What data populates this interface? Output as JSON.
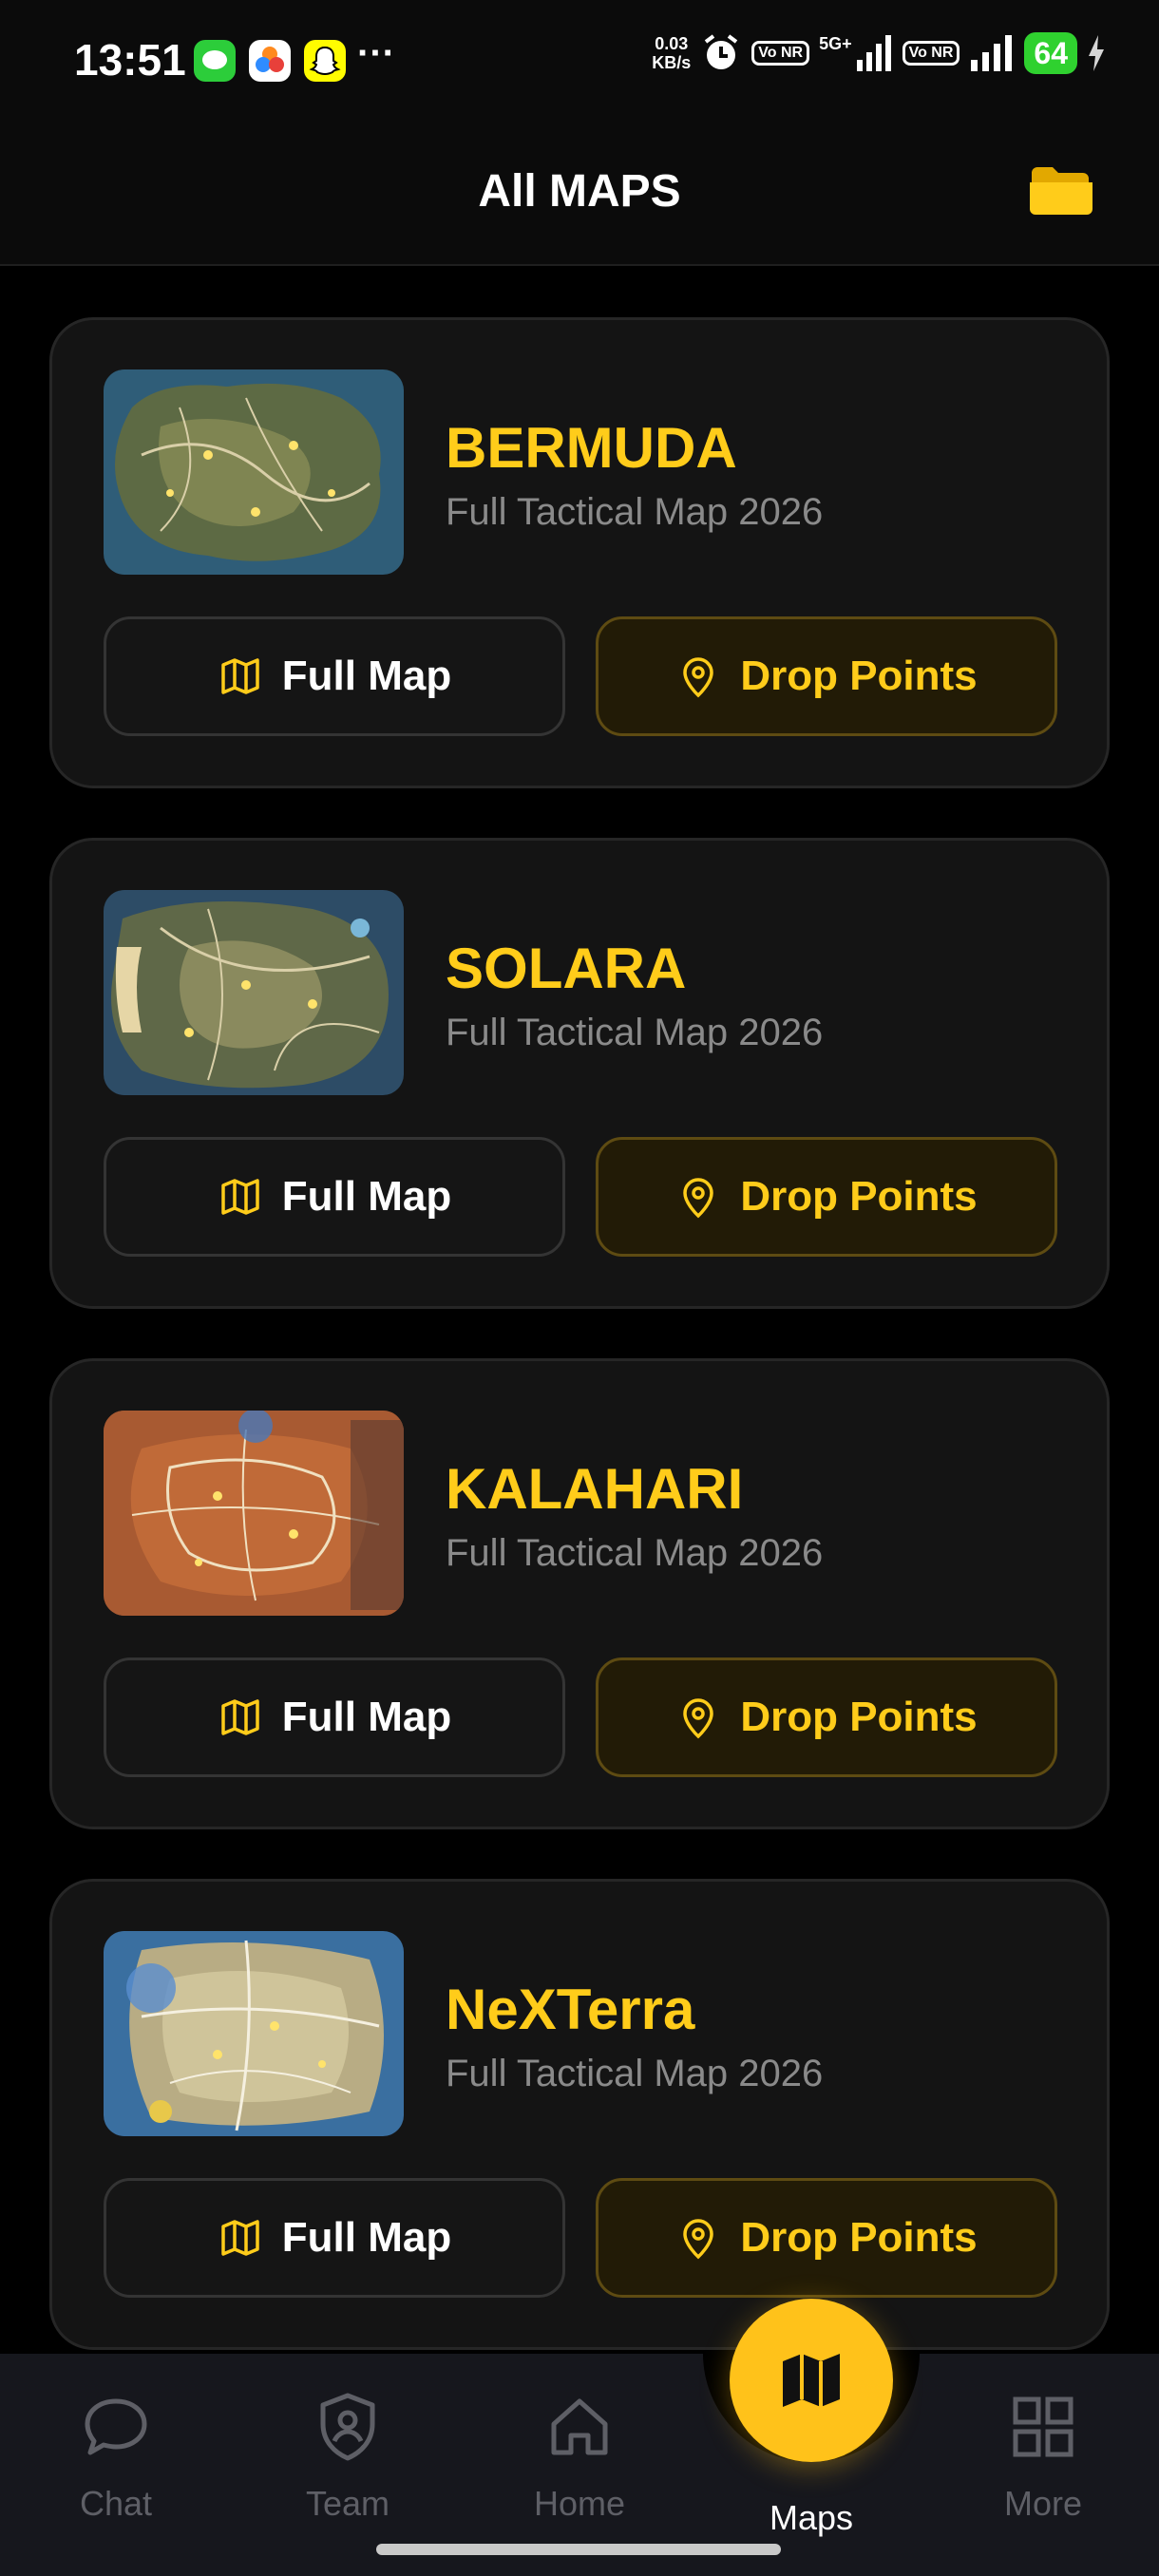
{
  "status_bar": {
    "time": "13:51",
    "speed_value": "0.03",
    "speed_unit": "KB/s",
    "network": "5G+",
    "volte_1": "Vo NR",
    "volte_2": "Vo NR",
    "battery": "64"
  },
  "header": {
    "title": "All MAPS",
    "folder_icon": "folder-icon"
  },
  "maps": [
    {
      "name": "BERMUDA",
      "subtitle": "Full Tactical Map 2026",
      "full_map_label": "Full Map",
      "drop_points_label": "Drop Points"
    },
    {
      "name": "SOLARA",
      "subtitle": "Full Tactical Map 2026",
      "full_map_label": "Full Map",
      "drop_points_label": "Drop Points"
    },
    {
      "name": "KALAHARI",
      "subtitle": "Full Tactical Map 2026",
      "full_map_label": "Full Map",
      "drop_points_label": "Drop Points"
    },
    {
      "name": "NeXTerra",
      "subtitle": "Full Tactical Map 2026",
      "full_map_label": "Full Map",
      "drop_points_label": "Drop Points"
    }
  ],
  "bottom_nav": {
    "items": [
      {
        "label": "Chat",
        "icon": "chat-icon"
      },
      {
        "label": "Team",
        "icon": "shield-user-icon"
      },
      {
        "label": "Home",
        "icon": "home-icon"
      },
      {
        "label": "Maps",
        "icon": "map-icon",
        "active": true
      },
      {
        "label": "More",
        "icon": "grid-icon"
      }
    ]
  },
  "colors": {
    "accent": "#ffcc1a",
    "background": "#000000",
    "card": "#141414",
    "nav_bg": "#16171d",
    "inactive": "#5e5f66"
  }
}
